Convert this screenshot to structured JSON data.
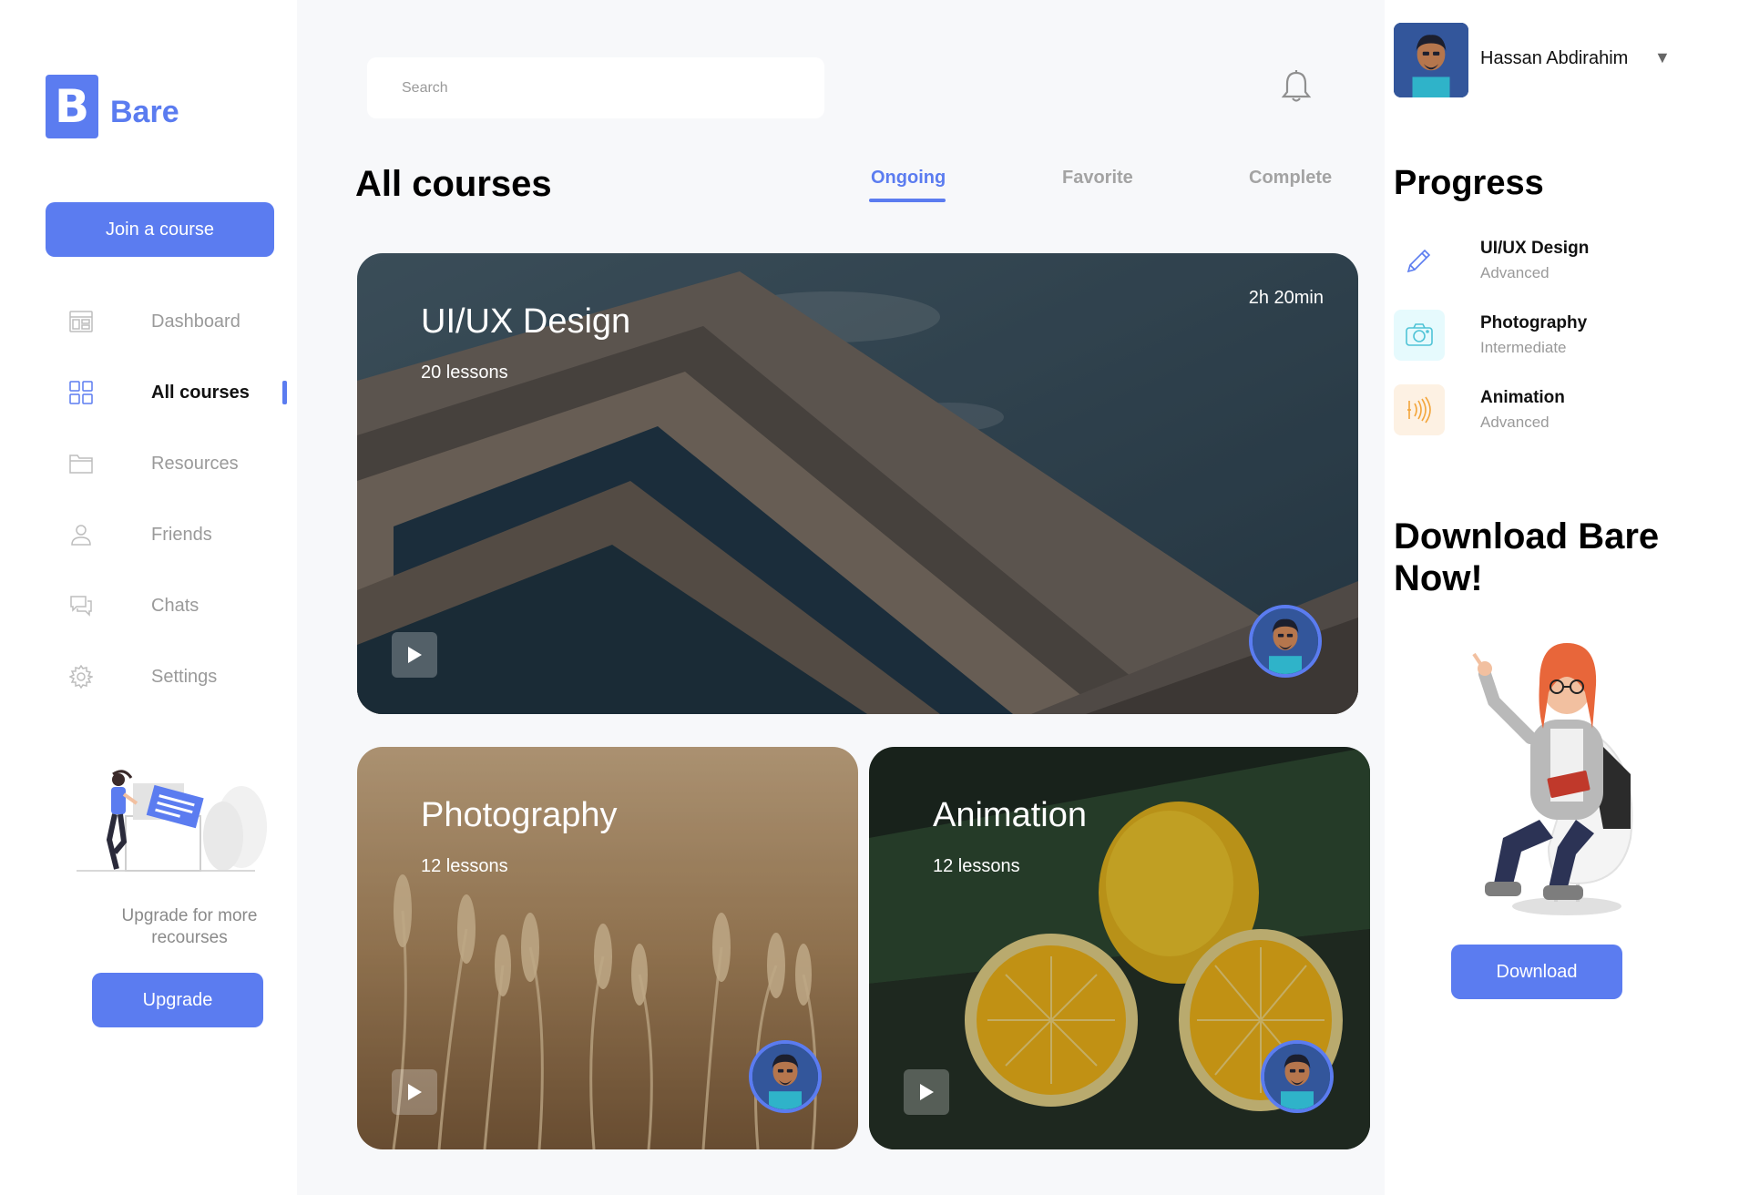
{
  "brand": {
    "logo_letter": "B",
    "name": "Bare"
  },
  "sidebar": {
    "join_label": "Join a course",
    "items": [
      {
        "label": "Dashboard",
        "icon": "dashboard-icon"
      },
      {
        "label": "All courses",
        "icon": "grid-icon",
        "active": true
      },
      {
        "label": "Resources",
        "icon": "folder-icon"
      },
      {
        "label": "Friends",
        "icon": "user-icon"
      },
      {
        "label": "Chats",
        "icon": "chat-icon"
      },
      {
        "label": "Settings",
        "icon": "gear-icon"
      }
    ],
    "upgrade_text": "Upgrade for more recourses",
    "upgrade_label": "Upgrade"
  },
  "header": {
    "search_placeholder": "Search",
    "notification_icon": "bell-icon"
  },
  "main": {
    "title": "All courses",
    "tabs": [
      {
        "label": "Ongoing",
        "active": true
      },
      {
        "label": "Favorite"
      },
      {
        "label": "Complete"
      }
    ],
    "courses": [
      {
        "title": "UI/UX Design",
        "lessons": "20 lessons",
        "duration": "2h 20min"
      },
      {
        "title": "Photography",
        "lessons": "12 lessons"
      },
      {
        "title": "Animation",
        "lessons": "12 lessons"
      }
    ]
  },
  "profile": {
    "name": "Hassan Abdirahim",
    "caret": "▼"
  },
  "progress": {
    "title": "Progress",
    "items": [
      {
        "name": "UI/UX Design",
        "level": "Advanced",
        "icon": "pencil-icon"
      },
      {
        "name": "Photography",
        "level": "Intermediate",
        "icon": "camera-icon"
      },
      {
        "name": "Animation",
        "level": "Advanced",
        "icon": "sound-wave-icon"
      }
    ]
  },
  "download": {
    "title": "Download Bare Now!",
    "button_label": "Download"
  },
  "colors": {
    "accent": "#5b7cf0",
    "background": "#f7f8fa",
    "photo_tint": "#e6fafd",
    "anim_tint": "#fdf1e3"
  }
}
